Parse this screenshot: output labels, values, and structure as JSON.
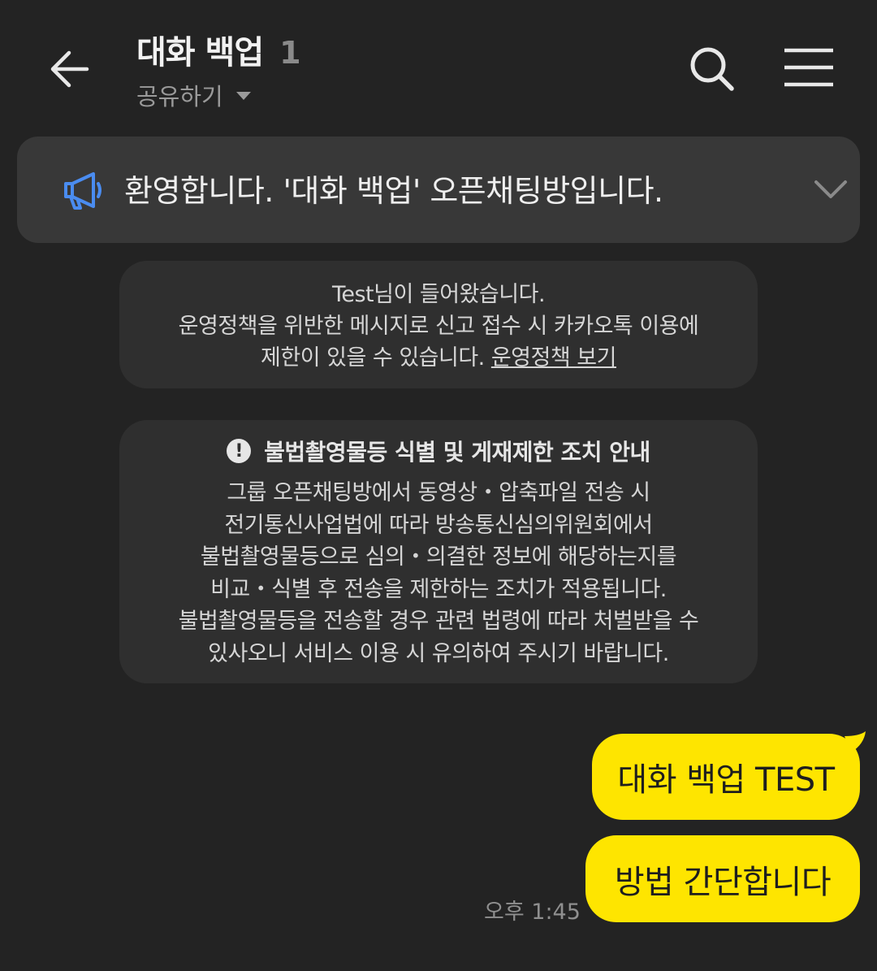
{
  "header": {
    "title": "대화 백업",
    "member_count": "1",
    "share_label": "공유하기",
    "icons": [
      "back-arrow-icon",
      "search-icon",
      "hamburger-menu-icon",
      "caret-down-icon"
    ]
  },
  "notice": {
    "text": "환영합니다. '대화 백업' 오픈채팅방입니다.",
    "icon": "megaphone-icon",
    "accent_color": "#4a8cf0"
  },
  "system_message": {
    "lines": [
      "Test님이 들어왔습니다.",
      "운영정책을 위반한 메시지로 신고 접수 시 카카오톡 이용에"
    ],
    "line3_text": "제한이 있을 수 있습니다. ",
    "policy_link": "운영정책 보기"
  },
  "illegal_content_notice": {
    "title": "불법촬영물등 식별 및 게재제한 조치 안내",
    "lines": [
      "그룹 오픈채팅방에서 동영상・압축파일 전송 시",
      "전기통신사업법에 따라 방송통신심의위원회에서",
      "불법촬영물등으로 심의・의결한 정보에 해당하는지를",
      "비교・식별 후 전송을 제한하는 조치가 적용됩니다.",
      "불법촬영물등을 전송할 경우 관련 법령에 따라 처벌받을 수",
      "있사오니 서비스 이용 시 유의하여 주시기 바랍니다."
    ]
  },
  "messages": [
    {
      "text": "대화 백업 TEST"
    },
    {
      "text": "방법 간단합니다"
    }
  ],
  "last_time": "오후 1:45",
  "colors": {
    "background": "#232323",
    "bubble_outgoing": "#fee500",
    "notice_bg": "#383838",
    "system_bg": "#2f2f2f"
  }
}
